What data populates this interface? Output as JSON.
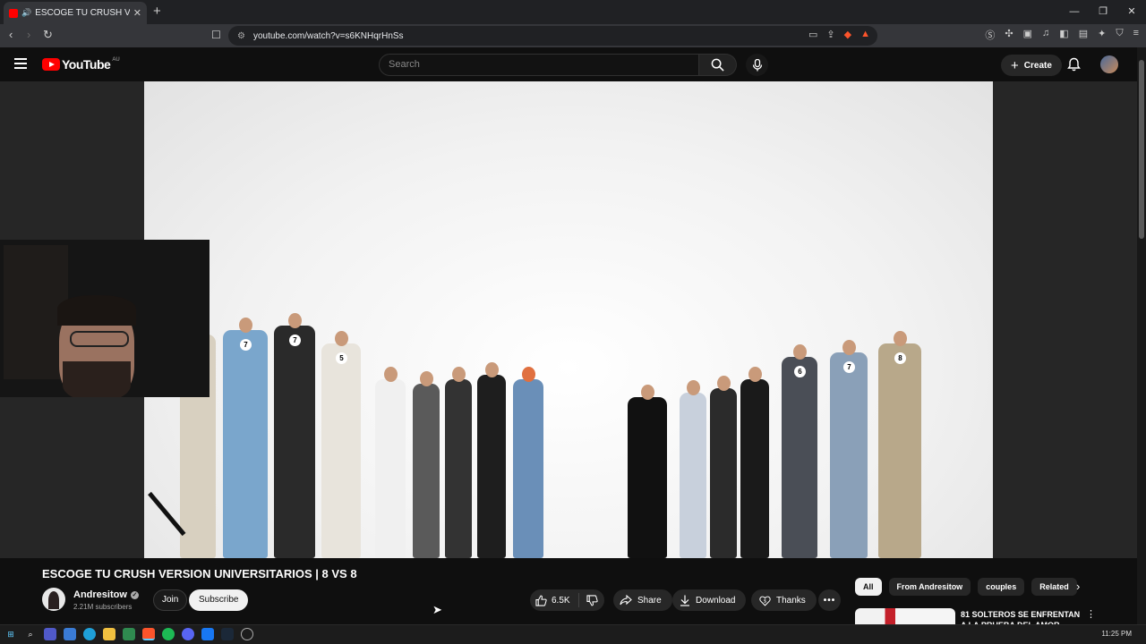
{
  "browser": {
    "tab_title": "ESCOGE TU CRUSH VERSION",
    "new_tab": "+",
    "tab_close": "✕",
    "url": "youtube.com/watch?v=s6KNHqrHnSs",
    "window_controls": [
      "—",
      "❐",
      "✕"
    ]
  },
  "youtube": {
    "logo_text": "YouTube",
    "country_code": "AU",
    "search_placeholder": "Search",
    "create_label": "Create"
  },
  "video": {
    "contestant_tags": [
      "7",
      "7",
      "5",
      "6",
      "7",
      "8"
    ]
  },
  "below_video": {
    "title": "ESCOGE TU CRUSH VERSION UNIVERSITARIOS | 8 VS 8",
    "channel_name": "Andresitow",
    "subscribers": "2.21M subscribers",
    "join_label": "Join",
    "subscribe_label": "Subscribe",
    "like_count": "6.5K",
    "share_label": "Share",
    "download_label": "Download",
    "thanks_label": "Thanks",
    "more_label": "•••"
  },
  "sidebar": {
    "chips": [
      "All",
      "From Andresitow",
      "couples",
      "Related"
    ],
    "related_title": "81 SOLTEROS SE ENFRENTAN A LA PRUEBA DEL AMOR"
  },
  "taskbar": {
    "clock": "11:25 PM"
  },
  "colors": {
    "yt_red": "#ff0000",
    "background": "#0f0f0f",
    "chip_bg": "#272727"
  }
}
